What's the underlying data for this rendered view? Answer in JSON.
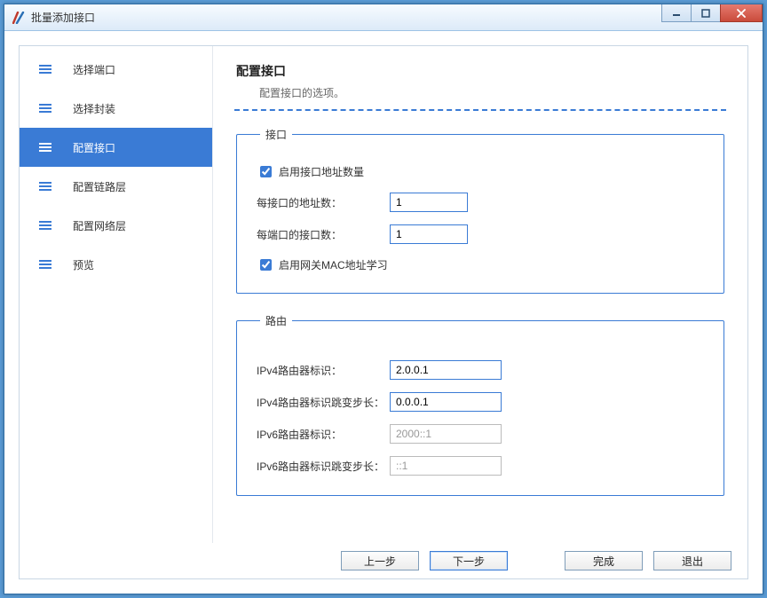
{
  "window": {
    "title": "批量添加接口"
  },
  "sidebar": {
    "items": [
      {
        "label": "选择端口"
      },
      {
        "label": "选择封装"
      },
      {
        "label": "配置接口"
      },
      {
        "label": "配置链路层"
      },
      {
        "label": "配置网络层"
      },
      {
        "label": "预览"
      }
    ],
    "activeIndex": 2
  },
  "page": {
    "title": "配置接口",
    "desc": "配置接口的选项。"
  },
  "group_interface": {
    "legend": "接口",
    "enable_addr_count_label": "启用接口地址数量",
    "enable_addr_count_checked": true,
    "addr_per_if_label": "每接口的地址数：",
    "addr_per_if_value": "1",
    "if_per_port_label": "每端口的接口数：",
    "if_per_port_value": "1",
    "enable_mac_learn_label": "启用网关MAC地址学习",
    "enable_mac_learn_checked": true
  },
  "group_route": {
    "legend": "路由",
    "ipv4_id_label": "IPv4路由器标识：",
    "ipv4_id_value": "2.0.0.1",
    "ipv4_step_label": "IPv4路由器标识跳变步长：",
    "ipv4_step_value": "0.0.0.1",
    "ipv6_id_label": "IPv6路由器标识：",
    "ipv6_id_value": "2000::1",
    "ipv6_step_label": "IPv6路由器标识跳变步长：",
    "ipv6_step_value": "::1"
  },
  "footer": {
    "prev": "上一步",
    "next": "下一步",
    "finish": "完成",
    "exit": "退出"
  }
}
